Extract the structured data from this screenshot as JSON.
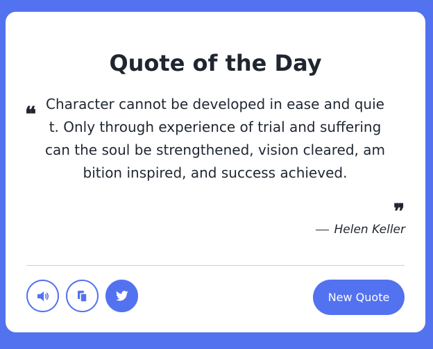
{
  "header": {
    "title": "Quote of the Day"
  },
  "quote": {
    "text": "Character cannot be developed in ease and quiet. Only through experience of trial and suffering can the soul be strengthened, vision cleared, ambition inspired, and success achieved.",
    "author": "Helen Keller"
  },
  "actions": {
    "speak_icon": "volume-icon",
    "copy_icon": "copy-icon",
    "tweet_icon": "twitter-icon",
    "new_quote_label": "New Quote"
  },
  "colors": {
    "accent": "#5372f0",
    "text": "#1f2630",
    "card": "#ffffff"
  }
}
